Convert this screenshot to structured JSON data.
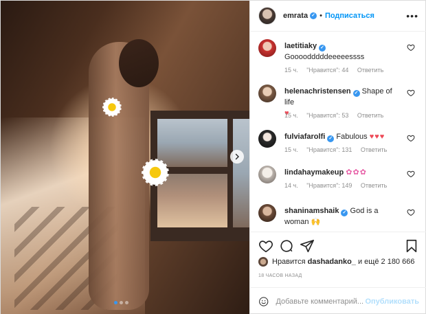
{
  "post": {
    "author": "emrata",
    "follow_label": "Подписаться",
    "separator": "•",
    "more_label": "•••",
    "carousel_dots": 3,
    "carousel_active_index": 0
  },
  "comments": [
    {
      "username": "laetitiaky",
      "verified": true,
      "text": "Goooodddddeeeeessss",
      "emoji": "",
      "time": "15 ч.",
      "likes": "\"Нравится\": 44",
      "reply": "Ответить"
    },
    {
      "username": "helenachristensen",
      "verified": true,
      "text": "Shape of life",
      "emoji": "♥",
      "time": "15 ч.",
      "likes": "\"Нравится\": 53",
      "reply": "Ответить"
    },
    {
      "username": "fulviafarolfi",
      "verified": true,
      "text": "Fabulous",
      "emoji": "♥♥♥",
      "time": "15 ч.",
      "likes": "\"Нравится\": 131",
      "reply": "Ответить"
    },
    {
      "username": "lindahaymakeup",
      "verified": true,
      "text": "",
      "emoji": "✿✿✿",
      "time": "14 ч.",
      "likes": "\"Нравится\": 149",
      "reply": "Ответить"
    },
    {
      "username": "shaninamshaik",
      "verified": true,
      "text": "God is a woman",
      "emoji": "🙌",
      "time": "",
      "likes": "",
      "reply": ""
    }
  ],
  "likes_line": {
    "prefix": "Нравится",
    "user": "dashadanko_",
    "suffix": "и ещё 2 180 666"
  },
  "timestamp": "18 ЧАСОВ НАЗАД",
  "add_comment": {
    "placeholder": "Добавьте комментарий...",
    "publish_label": "Опубликовать"
  },
  "colors": {
    "accent": "#0095f6",
    "heart": "#ed4956",
    "publish_disabled": "#b2dffc",
    "muted": "#8e8e8e"
  },
  "icons": [
    "heart-icon",
    "comment-icon",
    "share-icon",
    "bookmark-icon",
    "smile-icon",
    "chevron-right-icon",
    "more-icon",
    "verified-icon"
  ]
}
